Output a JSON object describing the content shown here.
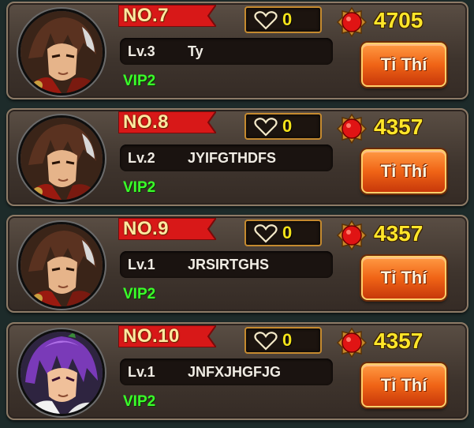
{
  "colors": {
    "card_bg": "#4a3f36",
    "rank_ribbon": "#d81818",
    "likes_border": "#c58a2f",
    "power_text": "#ffe62a",
    "vip_text": "#3aff2a",
    "button_orange": "#f06416"
  },
  "icons": {
    "heart": "heart-outline-icon",
    "power": "red-gem-medal-icon"
  },
  "players": [
    {
      "rank": "NO.7",
      "likes": "0",
      "power": "4705",
      "level": "Lv.3",
      "name": "Ty",
      "vip": "VIP2",
      "button": "Tỉ Thí",
      "avatar": "brown-hair-warrior"
    },
    {
      "rank": "NO.8",
      "likes": "0",
      "power": "4357",
      "level": "Lv.2",
      "name": "JYIFGTHDFS",
      "vip": "VIP2",
      "button": "Tỉ Thí",
      "avatar": "brown-hair-warrior"
    },
    {
      "rank": "NO.9",
      "likes": "0",
      "power": "4357",
      "level": "Lv.1",
      "name": "JRSIRTGHS",
      "vip": "VIP2",
      "button": "Tỉ Thí",
      "avatar": "brown-hair-warrior"
    },
    {
      "rank": "NO.10",
      "likes": "0",
      "power": "4357",
      "level": "Lv.1",
      "name": "JNFXJHGFJG",
      "vip": "VIP2",
      "button": "Tỉ Thí",
      "avatar": "purple-hair-warrior"
    }
  ]
}
